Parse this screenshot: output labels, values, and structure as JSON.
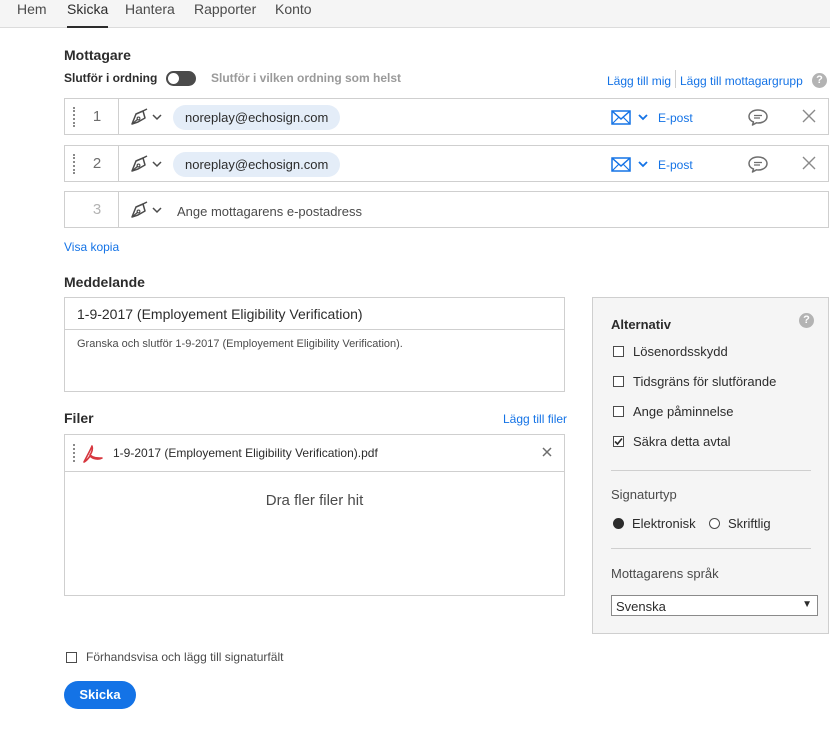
{
  "nav": {
    "tabs": [
      {
        "label": "Hem",
        "active": false
      },
      {
        "label": "Skicka",
        "active": true
      },
      {
        "label": "Hantera",
        "active": false
      },
      {
        "label": "Rapporter",
        "active": false
      },
      {
        "label": "Konto",
        "active": false
      }
    ]
  },
  "recipients": {
    "title": "Mottagare",
    "order_label": "Slutför i ordning",
    "order_any_label": "Slutför i vilken ordning som helst",
    "add_me": "Lägg till mig",
    "add_group": "Lägg till mottagargrupp",
    "help": "?",
    "rows": [
      {
        "number": "1",
        "email": "noreplay@echosign.com",
        "method": "E-post"
      },
      {
        "number": "2",
        "email": "noreplay@echosign.com",
        "method": "E-post"
      },
      {
        "number": "3",
        "placeholder": "Ange mottagarens e-postadress"
      }
    ],
    "show_copy": "Visa kopia"
  },
  "message": {
    "title": "Meddelande",
    "subject": "1-9-2017 (Employement Eligibility Verification)",
    "body": "Granska och slutför 1-9-2017 (Employement Eligibility Verification)."
  },
  "files": {
    "title": "Filer",
    "add_files": "Lägg till filer",
    "items": [
      {
        "name": "1-9-2017 (Employement Eligibility Verification).pdf"
      }
    ],
    "drop_text": "Dra fler filer hit"
  },
  "options": {
    "title": "Alternativ",
    "help": "?",
    "checkboxes": [
      {
        "label": "Lösenordsskydd",
        "checked": false
      },
      {
        "label": "Tidsgräns för slutförande",
        "checked": false
      },
      {
        "label": "Ange påminnelse",
        "checked": false
      },
      {
        "label": "Säkra detta avtal",
        "checked": true
      }
    ],
    "signature_type_label": "Signaturtyp",
    "signature_types": [
      {
        "label": "Elektronisk",
        "selected": true
      },
      {
        "label": "Skriftlig",
        "selected": false
      }
    ],
    "language_label": "Mottagarens språk",
    "language_value": "Svenska"
  },
  "footer": {
    "preview_label": "Förhandsvisa och lägg till signaturfält",
    "preview_checked": false,
    "send_label": "Skicka"
  },
  "colors": {
    "accent": "#1473e6",
    "chip_bg": "#e4edf8",
    "panel_bg": "#f5f5f5"
  }
}
